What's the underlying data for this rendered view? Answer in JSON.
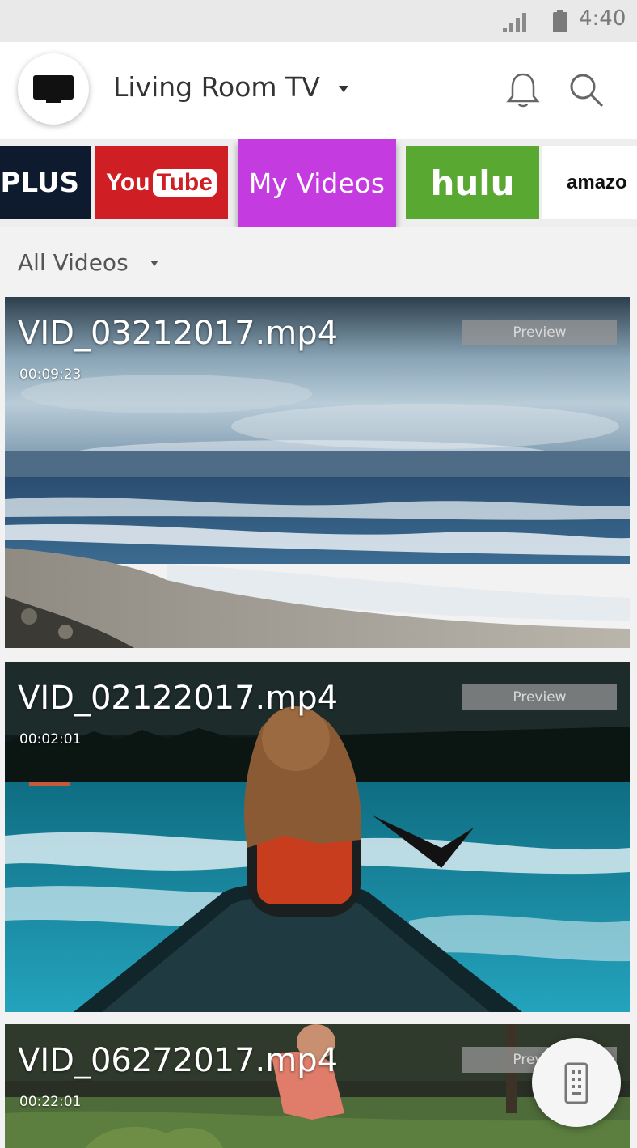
{
  "status_bar": {
    "time": "4:40",
    "signal_icon": "signal-icon",
    "battery_icon": "battery-icon"
  },
  "header": {
    "device_icon": "tv-icon",
    "device_name": "Living Room TV",
    "notifications_icon": "bell-icon",
    "search_icon": "search-icon"
  },
  "apps": [
    {
      "label": "PLUS"
    },
    {
      "label_a": "You",
      "label_b": "Tube"
    },
    {
      "label": "My Videos",
      "selected": true,
      "color": "#c43be0"
    },
    {
      "label": "hulu",
      "color": "#58a832"
    },
    {
      "label": "amazo"
    }
  ],
  "filter": {
    "label": "All Videos"
  },
  "videos": [
    {
      "name": "VID_03212017.mp4",
      "duration": "00:09:23",
      "preview_label": "Preview"
    },
    {
      "name": "VID_02122017.mp4",
      "duration": "00:02:01",
      "preview_label": "Preview"
    },
    {
      "name": "VID_06272017.mp4",
      "duration": "00:22:01",
      "preview_label": "Preview"
    }
  ],
  "remote_button": {
    "icon": "remote-control-icon"
  }
}
